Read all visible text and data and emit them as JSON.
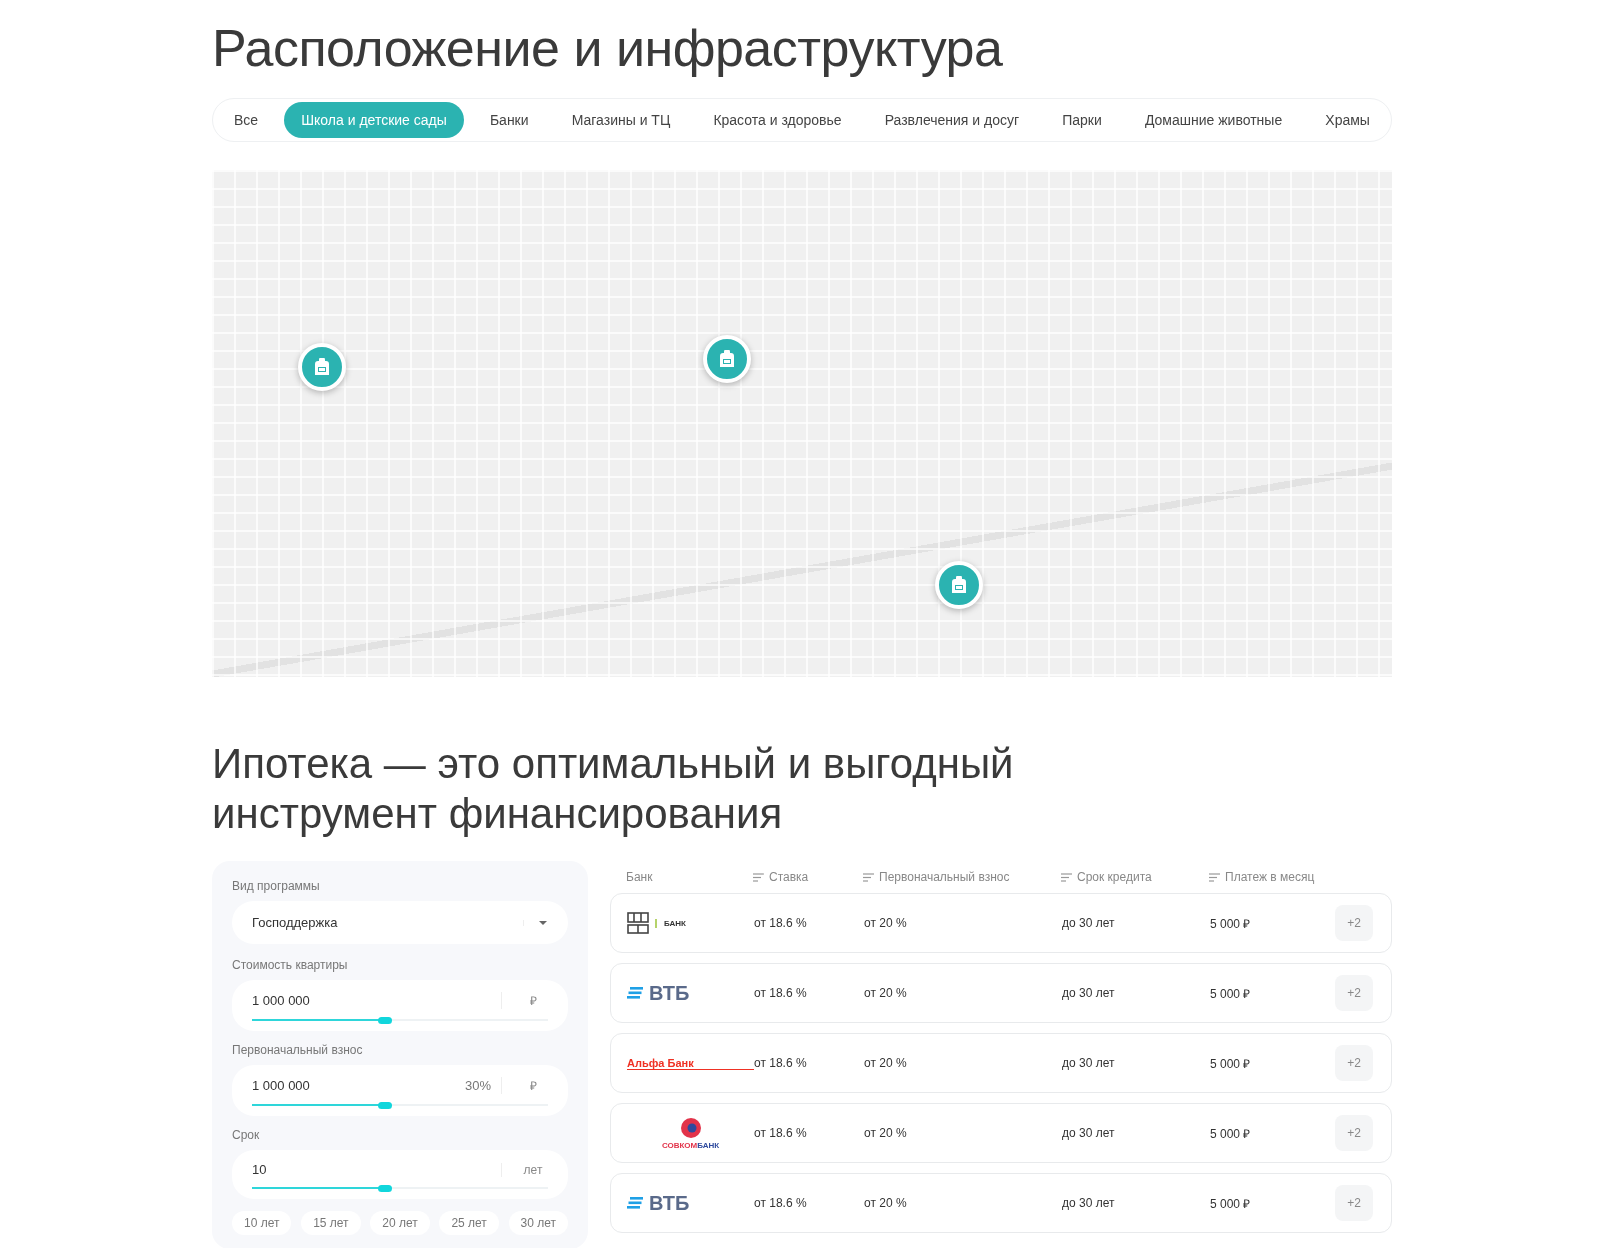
{
  "location": {
    "title": "Расположение и инфраструктура",
    "tabs": [
      {
        "label": "Все",
        "selected": false
      },
      {
        "label": "Школа и детские сады",
        "selected": true
      },
      {
        "label": "Банки",
        "selected": false
      },
      {
        "label": "Магазины и ТЦ",
        "selected": false
      },
      {
        "label": "Красота и здоровье",
        "selected": false
      },
      {
        "label": "Развлечения и досуг",
        "selected": false
      },
      {
        "label": "Парки",
        "selected": false
      },
      {
        "label": "Домашние животные",
        "selected": false
      },
      {
        "label": "Храмы",
        "selected": false
      }
    ]
  },
  "mortgage": {
    "title": "Ипотека — это оптимальный и выгодный инструмент финансирования",
    "calculator": {
      "program": {
        "label": "Вид программы",
        "value": "Господдержка"
      },
      "fields": [
        {
          "label": "Стоимость квартиры",
          "value": "1 000 000",
          "unit": "₽",
          "level": 0.45
        },
        {
          "label": "Первоначальный взнос",
          "value": "1 000 000",
          "percent": "30%",
          "unit": "₽",
          "level": 0.45
        },
        {
          "label": "Срок",
          "value": "10",
          "unit": "лет",
          "level": 0.45
        }
      ],
      "term_chips": [
        "10 лет",
        "15 лет",
        "20 лет",
        "25 лет",
        "30 лет"
      ]
    },
    "table": {
      "columns": [
        {
          "label": "Банк",
          "sortable": false
        },
        {
          "label": "Ставка",
          "sortable": true
        },
        {
          "label": "Первоначальный взнос",
          "sortable": true
        },
        {
          "label": "Срок кредита",
          "sortable": true
        },
        {
          "label": "Платеж в месяц",
          "sortable": true
        }
      ],
      "rows": [
        {
          "kind": "domrf",
          "bank_text": "БАНК",
          "rate": "от 18.6 %",
          "initial": "от 20 %",
          "term": "до 30 лет",
          "payment": "5 000 ₽",
          "more": "+2"
        },
        {
          "kind": "vtb",
          "bank_text": "ВТБ",
          "rate": "от 18.6 %",
          "initial": "от 20 %",
          "term": "до 30 лет",
          "payment": "5 000 ₽",
          "more": "+2"
        },
        {
          "kind": "alfa",
          "bank_text": "Альфа Банк",
          "rate": "от 18.6 %",
          "initial": "от 20 %",
          "term": "до 30 лет",
          "payment": "5 000 ₽",
          "more": "+2"
        },
        {
          "kind": "sovcom",
          "bank_text": "СОВКОМ",
          "bank_text2": "БАНК",
          "rate": "от 18.6 %",
          "initial": "от 20 %",
          "term": "до 30 лет",
          "payment": "5 000 ₽",
          "more": "+2"
        },
        {
          "kind": "vtb",
          "bank_text": "ВТБ",
          "rate": "от 18.6 %",
          "initial": "от 20 %",
          "term": "до 30 лет",
          "payment": "5 000 ₽",
          "more": "+2"
        }
      ]
    }
  }
}
